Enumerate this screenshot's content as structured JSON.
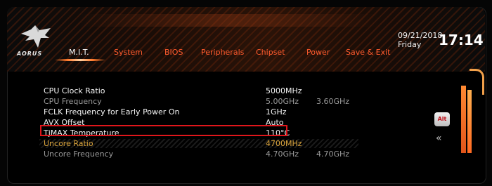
{
  "header": {
    "brand": "AORUS",
    "date": "09/21/2018",
    "day": "Friday",
    "time": "17:14"
  },
  "tabs": [
    {
      "label": "M.I.T.",
      "active": true
    },
    {
      "label": "System",
      "active": false
    },
    {
      "label": "BIOS",
      "active": false
    },
    {
      "label": "Peripherals",
      "active": false
    },
    {
      "label": "Chipset",
      "active": false
    },
    {
      "label": "Power",
      "active": false
    },
    {
      "label": "Save & Exit",
      "active": false
    }
  ],
  "settings": [
    {
      "label": "CPU Clock Ratio",
      "value": "5000MHz",
      "extra": "",
      "style": "white"
    },
    {
      "label": "CPU Frequency",
      "value": "5.00GHz",
      "extra": "3.60GHz",
      "style": "dim"
    },
    {
      "label": "FCLK Frequency for Early Power On",
      "value": "1GHz",
      "extra": "",
      "style": "white"
    },
    {
      "label": "AVX Offset",
      "value": "Auto",
      "extra": "",
      "style": "white"
    },
    {
      "label": "TjMAX Temperature",
      "value": "110°C",
      "extra": "",
      "style": "white",
      "highlighted": true
    },
    {
      "label": "Uncore Ratio",
      "value": "4700MHz",
      "extra": "",
      "style": "gold",
      "selected": true
    },
    {
      "label": "Uncore Frequency",
      "value": "4.70GHz",
      "extra": "4.70GHz",
      "style": "dim"
    }
  ],
  "side": {
    "alt_label": "Alt",
    "back_glyph": "«"
  },
  "colors": {
    "accent": "#ff5b2e",
    "highlight_border": "#e0161b",
    "selected_text": "#d8a23a",
    "dim_text": "#9a9a9a"
  }
}
